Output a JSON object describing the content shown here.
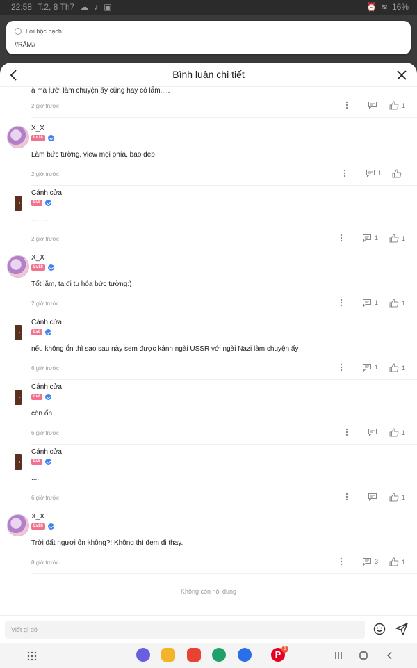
{
  "status": {
    "time": "22:58",
    "date": "T.2, 8 Th7",
    "battery": "16%"
  },
  "notification": {
    "app_name": "Lời bộc bạch",
    "message": "//RĂM//"
  },
  "header": {
    "title": "Bình luận chi tiết"
  },
  "comments": [
    {
      "text": "à mà lưỡi làm chuyện ấy cũng hay có lắm.....",
      "time": "2 giờ trước",
      "replies": "",
      "likes": "1"
    },
    {
      "user": "X_X",
      "level": "Lv18",
      "avatar": "xx",
      "text": "Làm bức tường, view mọi phía, bao đẹp",
      "time": "2 giờ trước",
      "replies": "1",
      "likes": ""
    },
    {
      "user": "Cánh cửa",
      "level": "Lv8",
      "avatar": "door",
      "text": ".........",
      "time": "2 giờ trước",
      "replies": "1",
      "likes": "1"
    },
    {
      "user": "X_X",
      "level": "Lv18",
      "avatar": "xx",
      "text": "Tốt lắm, ta đi tu hóa bức tường:)",
      "time": "2 giờ trước",
      "replies": "1",
      "likes": "1"
    },
    {
      "user": "Cánh cửa",
      "level": "Lv8",
      "avatar": "door",
      "text": "nếu không ổn thì sao sau này sem được kánh ngài USSR với ngài Nazi làm chuyện ấy",
      "time": "6 giờ trước",
      "replies": "1",
      "likes": "1"
    },
    {
      "user": "Cánh cửa",
      "level": "Lv8",
      "avatar": "door",
      "text": "còn ổn",
      "time": "6 giờ trước",
      "replies": "",
      "likes": "1"
    },
    {
      "user": "Cánh cửa",
      "level": "Lv8",
      "avatar": "door",
      "text": ".....",
      "time": "6 giờ trước",
      "replies": "",
      "likes": "1"
    },
    {
      "user": "X_X",
      "level": "Lv18",
      "avatar": "xx",
      "text": "Trời đất ngươi ổn không?! Không thì đem đi thay.",
      "time": "8 giờ trước",
      "replies": "3",
      "likes": "1"
    }
  ],
  "end_text": "Không còn nội dung",
  "input": {
    "placeholder": "Viết gì đó"
  },
  "dock": {
    "badge": "5"
  },
  "colors": {
    "level_badge": "#f0728c",
    "verify": "#3d82f0"
  }
}
